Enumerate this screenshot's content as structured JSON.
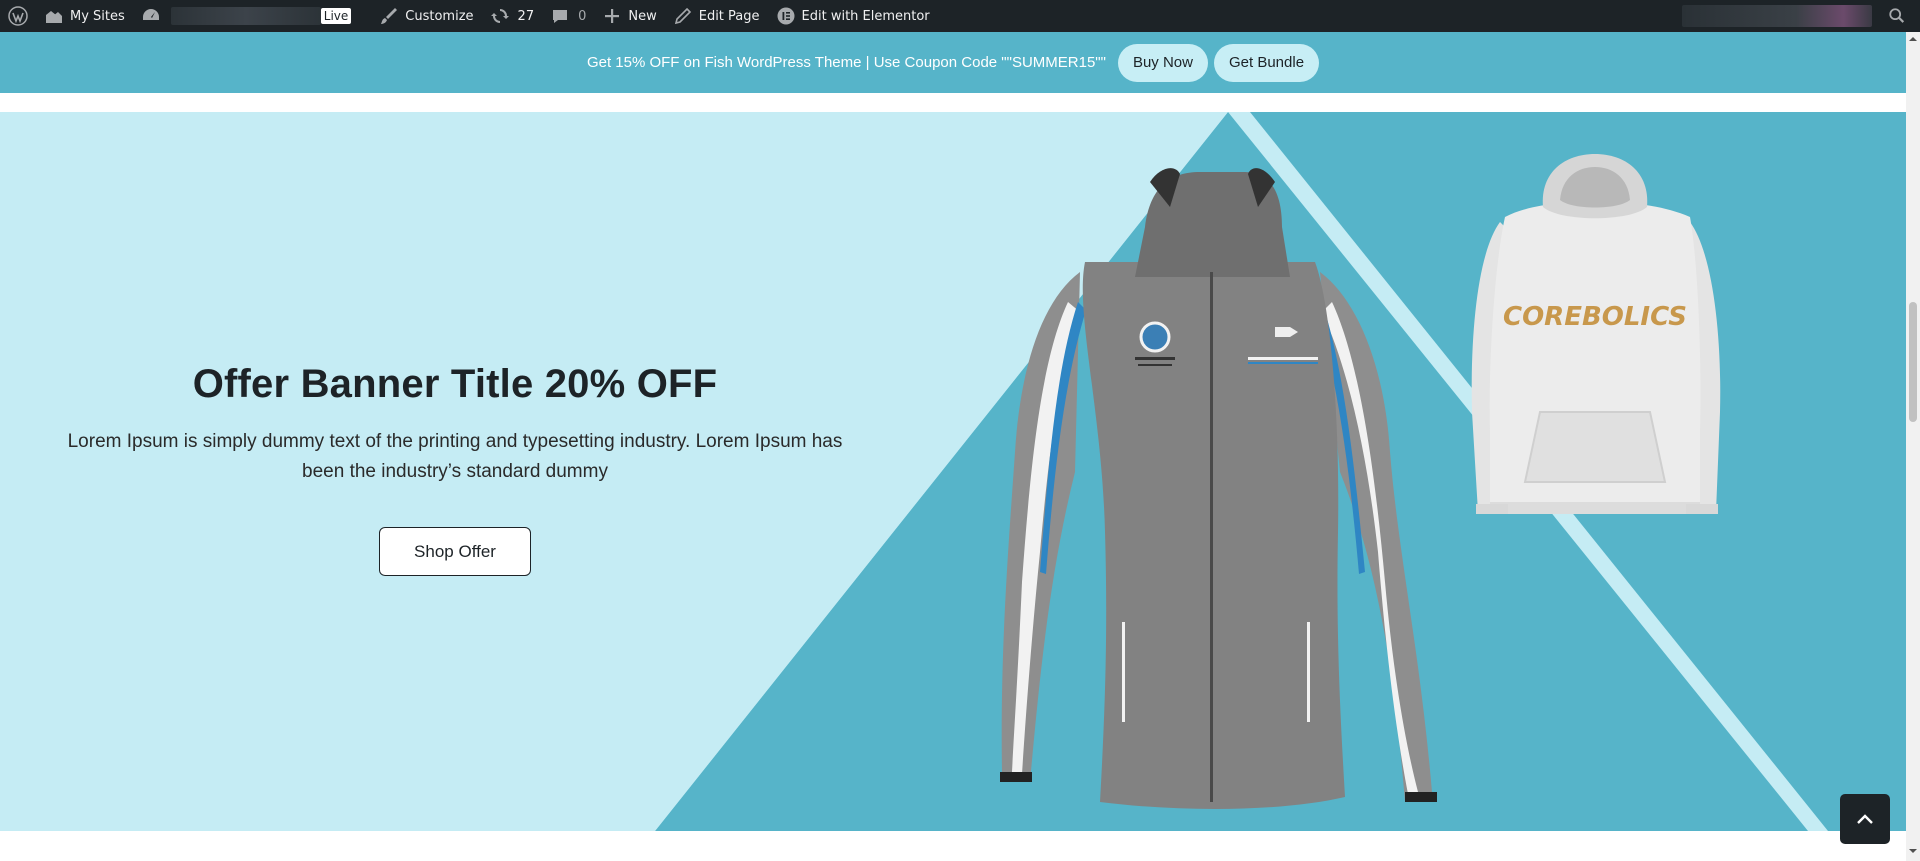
{
  "adminbar": {
    "my_sites": "My Sites",
    "live": "Live",
    "customize": "Customize",
    "updates_count": "27",
    "comments_count": "0",
    "new": "New",
    "edit_page": "Edit Page",
    "edit_elementor": "Edit with Elementor",
    "icons": [
      "wordpress-icon",
      "my-sites-icon",
      "dashboard-icon",
      "brush-icon",
      "updates-icon",
      "comment-icon",
      "plus-icon",
      "pencil-icon",
      "elementor-icon",
      "search-icon"
    ]
  },
  "promo": {
    "text": "Get 15% OFF on Fish WordPress Theme | Use Coupon Code \"\"SUMMER15\"\"",
    "buy_now": "Buy Now",
    "get_bundle": "Get Bundle"
  },
  "hero": {
    "title": "Offer Banner Title 20% OFF",
    "description": "Lorem Ipsum is simply dummy text of the printing and typesetting industry. Lorem Ipsum has been the industry’s standard dummy",
    "button": "Shop Offer",
    "hoodie_print": "COREBOLICS"
  },
  "colors": {
    "adminbar_bg": "#1d2327",
    "promo_bg": "#56b4c9",
    "promo_btn_bg": "#c7eef5",
    "hero_light": "#c5ecf4",
    "hero_dark": "#56b4c9"
  }
}
